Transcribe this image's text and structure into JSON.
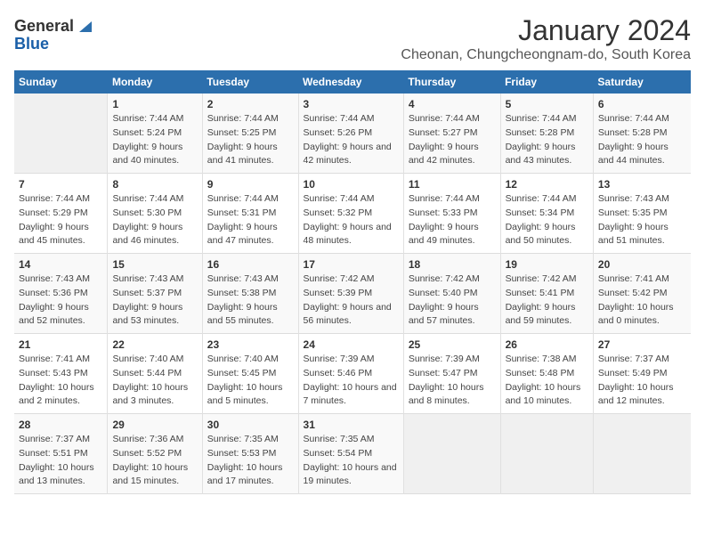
{
  "header": {
    "logo_general": "General",
    "logo_blue": "Blue",
    "month_title": "January 2024",
    "location": "Cheonan, Chungcheongnam-do, South Korea"
  },
  "days_of_week": [
    "Sunday",
    "Monday",
    "Tuesday",
    "Wednesday",
    "Thursday",
    "Friday",
    "Saturday"
  ],
  "weeks": [
    [
      {
        "day": "",
        "empty": true
      },
      {
        "day": "1",
        "sunrise": "Sunrise: 7:44 AM",
        "sunset": "Sunset: 5:24 PM",
        "daylight": "Daylight: 9 hours and 40 minutes."
      },
      {
        "day": "2",
        "sunrise": "Sunrise: 7:44 AM",
        "sunset": "Sunset: 5:25 PM",
        "daylight": "Daylight: 9 hours and 41 minutes."
      },
      {
        "day": "3",
        "sunrise": "Sunrise: 7:44 AM",
        "sunset": "Sunset: 5:26 PM",
        "daylight": "Daylight: 9 hours and 42 minutes."
      },
      {
        "day": "4",
        "sunrise": "Sunrise: 7:44 AM",
        "sunset": "Sunset: 5:27 PM",
        "daylight": "Daylight: 9 hours and 42 minutes."
      },
      {
        "day": "5",
        "sunrise": "Sunrise: 7:44 AM",
        "sunset": "Sunset: 5:28 PM",
        "daylight": "Daylight: 9 hours and 43 minutes."
      },
      {
        "day": "6",
        "sunrise": "Sunrise: 7:44 AM",
        "sunset": "Sunset: 5:28 PM",
        "daylight": "Daylight: 9 hours and 44 minutes."
      }
    ],
    [
      {
        "day": "7",
        "sunrise": "Sunrise: 7:44 AM",
        "sunset": "Sunset: 5:29 PM",
        "daylight": "Daylight: 9 hours and 45 minutes."
      },
      {
        "day": "8",
        "sunrise": "Sunrise: 7:44 AM",
        "sunset": "Sunset: 5:30 PM",
        "daylight": "Daylight: 9 hours and 46 minutes."
      },
      {
        "day": "9",
        "sunrise": "Sunrise: 7:44 AM",
        "sunset": "Sunset: 5:31 PM",
        "daylight": "Daylight: 9 hours and 47 minutes."
      },
      {
        "day": "10",
        "sunrise": "Sunrise: 7:44 AM",
        "sunset": "Sunset: 5:32 PM",
        "daylight": "Daylight: 9 hours and 48 minutes."
      },
      {
        "day": "11",
        "sunrise": "Sunrise: 7:44 AM",
        "sunset": "Sunset: 5:33 PM",
        "daylight": "Daylight: 9 hours and 49 minutes."
      },
      {
        "day": "12",
        "sunrise": "Sunrise: 7:44 AM",
        "sunset": "Sunset: 5:34 PM",
        "daylight": "Daylight: 9 hours and 50 minutes."
      },
      {
        "day": "13",
        "sunrise": "Sunrise: 7:43 AM",
        "sunset": "Sunset: 5:35 PM",
        "daylight": "Daylight: 9 hours and 51 minutes."
      }
    ],
    [
      {
        "day": "14",
        "sunrise": "Sunrise: 7:43 AM",
        "sunset": "Sunset: 5:36 PM",
        "daylight": "Daylight: 9 hours and 52 minutes."
      },
      {
        "day": "15",
        "sunrise": "Sunrise: 7:43 AM",
        "sunset": "Sunset: 5:37 PM",
        "daylight": "Daylight: 9 hours and 53 minutes."
      },
      {
        "day": "16",
        "sunrise": "Sunrise: 7:43 AM",
        "sunset": "Sunset: 5:38 PM",
        "daylight": "Daylight: 9 hours and 55 minutes."
      },
      {
        "day": "17",
        "sunrise": "Sunrise: 7:42 AM",
        "sunset": "Sunset: 5:39 PM",
        "daylight": "Daylight: 9 hours and 56 minutes."
      },
      {
        "day": "18",
        "sunrise": "Sunrise: 7:42 AM",
        "sunset": "Sunset: 5:40 PM",
        "daylight": "Daylight: 9 hours and 57 minutes."
      },
      {
        "day": "19",
        "sunrise": "Sunrise: 7:42 AM",
        "sunset": "Sunset: 5:41 PM",
        "daylight": "Daylight: 9 hours and 59 minutes."
      },
      {
        "day": "20",
        "sunrise": "Sunrise: 7:41 AM",
        "sunset": "Sunset: 5:42 PM",
        "daylight": "Daylight: 10 hours and 0 minutes."
      }
    ],
    [
      {
        "day": "21",
        "sunrise": "Sunrise: 7:41 AM",
        "sunset": "Sunset: 5:43 PM",
        "daylight": "Daylight: 10 hours and 2 minutes."
      },
      {
        "day": "22",
        "sunrise": "Sunrise: 7:40 AM",
        "sunset": "Sunset: 5:44 PM",
        "daylight": "Daylight: 10 hours and 3 minutes."
      },
      {
        "day": "23",
        "sunrise": "Sunrise: 7:40 AM",
        "sunset": "Sunset: 5:45 PM",
        "daylight": "Daylight: 10 hours and 5 minutes."
      },
      {
        "day": "24",
        "sunrise": "Sunrise: 7:39 AM",
        "sunset": "Sunset: 5:46 PM",
        "daylight": "Daylight: 10 hours and 7 minutes."
      },
      {
        "day": "25",
        "sunrise": "Sunrise: 7:39 AM",
        "sunset": "Sunset: 5:47 PM",
        "daylight": "Daylight: 10 hours and 8 minutes."
      },
      {
        "day": "26",
        "sunrise": "Sunrise: 7:38 AM",
        "sunset": "Sunset: 5:48 PM",
        "daylight": "Daylight: 10 hours and 10 minutes."
      },
      {
        "day": "27",
        "sunrise": "Sunrise: 7:37 AM",
        "sunset": "Sunset: 5:49 PM",
        "daylight": "Daylight: 10 hours and 12 minutes."
      }
    ],
    [
      {
        "day": "28",
        "sunrise": "Sunrise: 7:37 AM",
        "sunset": "Sunset: 5:51 PM",
        "daylight": "Daylight: 10 hours and 13 minutes."
      },
      {
        "day": "29",
        "sunrise": "Sunrise: 7:36 AM",
        "sunset": "Sunset: 5:52 PM",
        "daylight": "Daylight: 10 hours and 15 minutes."
      },
      {
        "day": "30",
        "sunrise": "Sunrise: 7:35 AM",
        "sunset": "Sunset: 5:53 PM",
        "daylight": "Daylight: 10 hours and 17 minutes."
      },
      {
        "day": "31",
        "sunrise": "Sunrise: 7:35 AM",
        "sunset": "Sunset: 5:54 PM",
        "daylight": "Daylight: 10 hours and 19 minutes."
      },
      {
        "day": "",
        "empty": true
      },
      {
        "day": "",
        "empty": true
      },
      {
        "day": "",
        "empty": true
      }
    ]
  ]
}
